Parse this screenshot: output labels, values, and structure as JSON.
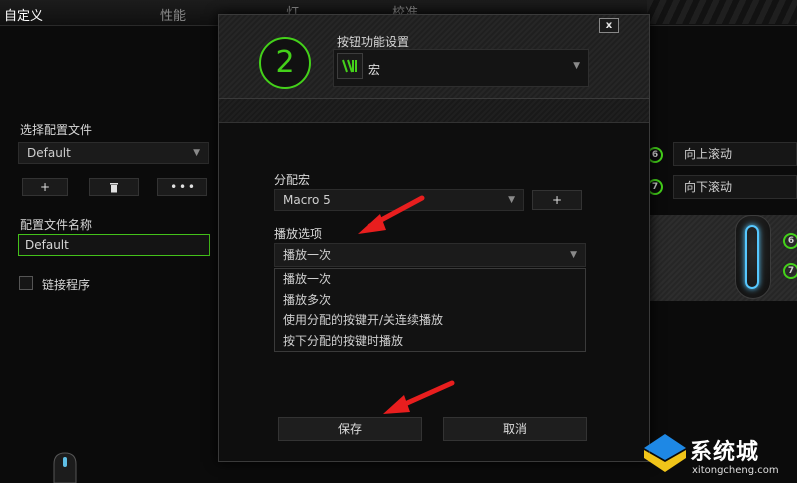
{
  "tabs": [
    {
      "label": "自定义"
    },
    {
      "label": "性能"
    },
    {
      "label": "灯"
    },
    {
      "label": "校准"
    }
  ],
  "left": {
    "profile_section_label": "选择配置文件",
    "profile_selected": "Default",
    "add_label": "+",
    "delete_icon": "trash-icon",
    "more_label": "• • •",
    "profile_name_label": "配置文件名称",
    "profile_name_value": "Default",
    "link_program_label": "链接程序"
  },
  "right": {
    "buttons": [
      {
        "num": "6",
        "label": "向上滚动"
      },
      {
        "num": "7",
        "label": "向下滚动"
      }
    ],
    "mouse_nums": [
      "6",
      "7"
    ]
  },
  "modal": {
    "close_label": "x",
    "button_number": "2",
    "title": "按钮功能设置",
    "function_selected": "宏",
    "assign_macro_label": "分配宏",
    "macro_selected": "Macro 5",
    "add_macro_label": "+",
    "playback_label": "播放选项",
    "playback_selected": "播放一次",
    "playback_options": [
      "播放一次",
      "播放多次",
      "使用分配的按键开/关连续播放",
      "按下分配的按键时播放"
    ],
    "save_label": "保存",
    "cancel_label": "取消"
  },
  "watermark": {
    "text": "系统城",
    "sub": "xitongcheng.com"
  },
  "colors": {
    "accent_green": "#44d11a",
    "arrow_red": "#e81e1e",
    "mouse_glow": "#56c8ff"
  }
}
